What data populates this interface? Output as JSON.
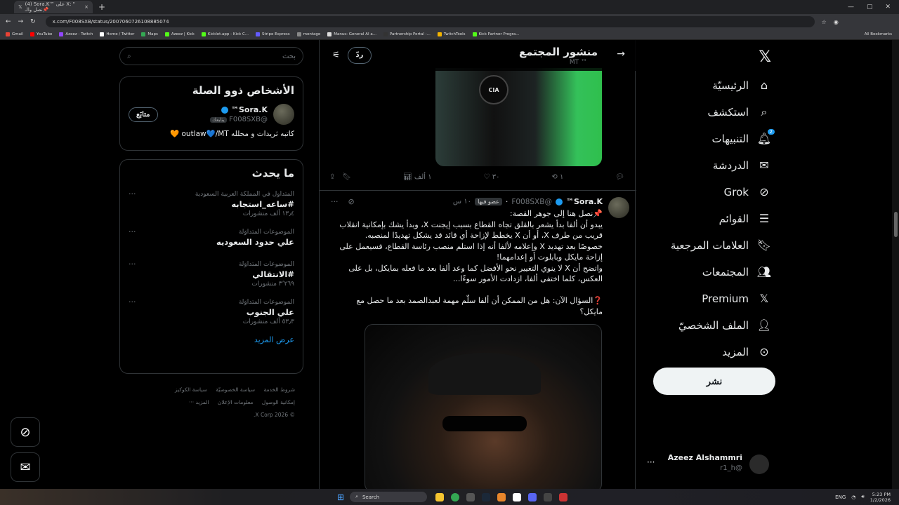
{
  "browser": {
    "tab_title": "(4) ‎Sora.K™‎ على X: \"‏ 📌نصل والـ",
    "url": "x.com/F008SXB/status/2007060726108885074",
    "bookmarks": [
      "Gmail",
      "YouTube",
      "Azeez - Twitch",
      "Home / Twitter",
      "Maps",
      "Azeez | Kick",
      "Kicklet.app - Kick C...",
      "Stripe Express",
      "montage",
      "Manus: General AI a...",
      "Partnership Portal -...",
      "TwitchTools",
      "Kick Partner Progra..."
    ],
    "all_bookmarks": "All Bookmarks"
  },
  "search": {
    "placeholder": "بحث"
  },
  "related": {
    "title": "الأشخاص ذوو الصلة",
    "user": {
      "name": "Sora.K™",
      "handle": "@F008SXB",
      "follows_you": "يتابعك",
      "follow_label": "متابَع",
      "bio": "كاتبه ثريدات و محلله outlaw💙/MT 🧡"
    }
  },
  "trends": {
    "title": "ما يحدث",
    "items": [
      {
        "category": "المتداول في المملكة العربية السعودية",
        "name": "#ساعه_استجابه",
        "count": "١٣٫٤ ألف منشورات"
      },
      {
        "category": "الموضوعات المتداوَلة",
        "name": "علي حدود السعوديه",
        "count": ""
      },
      {
        "category": "الموضوعات المتداوَلة",
        "name": "#الانتقالي",
        "count": "٣٬٢٦٩ منشورات"
      },
      {
        "category": "الموضوعات المتداوَلة",
        "name": "علي الجنوب",
        "count": "٥٣٫٣ ألف منشورات"
      }
    ],
    "show_more": "عرض المزيد"
  },
  "footer": {
    "links": [
      "شروط الخدمة",
      "سياسة الخصوصيّة",
      "سياسة الكوكيز",
      "إمكانية الوصول",
      "معلومات الإعلان",
      "المزيد ···"
    ],
    "copyright": "© 2026 X Corp."
  },
  "center": {
    "title": "منشور المجتمع",
    "subtitle": "MT ™",
    "reply_label": "ردّ",
    "media_top_label": "CIA",
    "actions": {
      "reply": "",
      "repost": "١",
      "like": "٣٠",
      "views": "١ ألف",
      "bookmark": "",
      "share": ""
    },
    "tweet": {
      "name": "Sora.K™",
      "handle": "@F008SXB",
      "sub_badge": "عضو فيها",
      "time": "١٠ س",
      "body": "📌نصل هنا إلى جوهر القصة:\nيبدو أن ألفا بدأ يشعر بالقلق تجاه القطاع بسبب إيجنت X، وبدأ يشك بإمكانية انقلاب قريب من طرف X، أو أن X يخطط لإزاحة أي قائد قد يشكل تهديدًا لمنصبه.\nخصوصًا بعد تهديد X وإعلامه لألفا أنه إذا استلم منصب رئاسة القطاع، فسيعمل على إزاحة مايكل وبابلوت أو إعدامهما!\nواتضح أن X لا ينوي التغيير نحو الأفضل كما وعد ألفا بعد ما فعله بمايكل، بل على العكس، كلما اختفى ألفا، ازدادت الأمور سوءًا...\n\n❓السؤال الآن: هل من الممكن أن ألفا سلّم مهمة لعبدالصمد بعد ما حصل مع مايكل؟"
    }
  },
  "nav": {
    "items": [
      {
        "label": "الرئيسيّة",
        "icon": "home-icon"
      },
      {
        "label": "استكشف",
        "icon": "search-icon"
      },
      {
        "label": "التنبيهات",
        "icon": "bell-icon",
        "badge": "2"
      },
      {
        "label": "الدردشة",
        "icon": "mail-icon"
      },
      {
        "label": "Grok",
        "icon": "grok-icon"
      },
      {
        "label": "القوائم",
        "icon": "list-icon"
      },
      {
        "label": "العلامات المرجعية",
        "icon": "bookmark-icon"
      },
      {
        "label": "المجتمعات",
        "icon": "communities-icon"
      },
      {
        "label": "Premium",
        "icon": "x-icon"
      },
      {
        "label": "الملف الشخصيّ",
        "icon": "person-icon"
      },
      {
        "label": "المزيد",
        "icon": "more-icon"
      }
    ],
    "post_label": "نشر"
  },
  "account": {
    "name": "Azeez Alshammri",
    "handle": "@r1_h"
  },
  "taskbar": {
    "search": "Search",
    "lang": "ENG",
    "time": "5:23 PM",
    "date": "1/2/2026"
  }
}
